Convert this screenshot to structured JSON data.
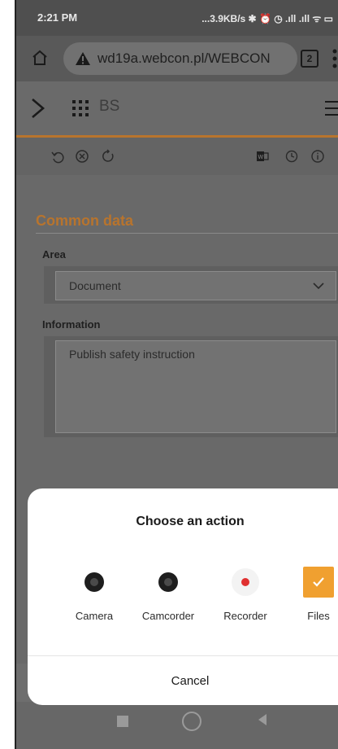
{
  "status_bar": {
    "time": "2:21 PM",
    "indicators": "...3.9KB/s ✱ ⏰ ◷ .ıll .ıll ᯤ ▭"
  },
  "browser": {
    "url": "wd19a.webcon.pl/WEBCON",
    "tab_count": "2"
  },
  "app_header": {
    "app_name": "BS"
  },
  "form": {
    "section_title": "Common data",
    "area": {
      "label": "Area",
      "value": "Document"
    },
    "information": {
      "label": "Information",
      "value": "Publish safety instruction"
    }
  },
  "sheet": {
    "title": "Choose an action",
    "options": [
      {
        "label": "Camera",
        "icon": "camera-icon"
      },
      {
        "label": "Camcorder",
        "icon": "camcorder-icon"
      },
      {
        "label": "Recorder",
        "icon": "recorder-icon"
      },
      {
        "label": "Files",
        "icon": "files-icon"
      }
    ],
    "cancel": "Cancel"
  },
  "colors": {
    "accent": "#b8742d",
    "recorder_red": "#e03030",
    "files_orange": "#f0a030"
  }
}
